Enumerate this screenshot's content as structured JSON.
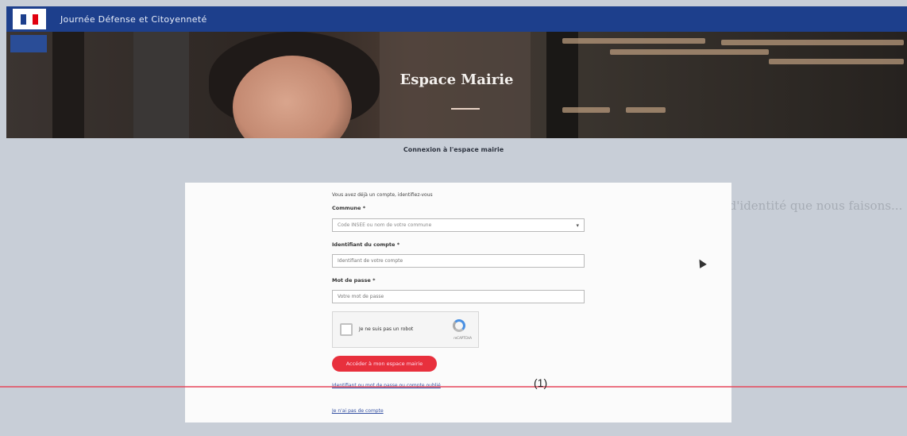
{
  "header": {
    "app_title": "Journée Défense et Citoyenneté",
    "side_tab": "",
    "flag_colors": [
      "#1d3f8c",
      "#ffffff",
      "#e1000f"
    ]
  },
  "hero": {
    "title": "Espace Mairie"
  },
  "subtitle": "Connexion à l'espace mairie",
  "ghost_text": "un numéro unique : celle des cartes d'identité que nous faisons...",
  "form": {
    "intro": "Vous avez déjà un compte, identifiez-vous",
    "commune_label": "Commune *",
    "commune_placeholder": "Code INSEE ou nom de votre commune",
    "identifiant_label": "Identifiant du compte *",
    "identifiant_placeholder": "Identifiant de votre compte",
    "password_label": "Mot de passe *",
    "password_placeholder": "Votre mot de passe",
    "captcha_label": "Je ne suis pas un robot",
    "captcha_brand": "reCAPTCHA",
    "submit_label": "Accéder à mon espace mairie",
    "forgot_link": "Identifiant ou mot de passe ou compte oublié",
    "no_account_link": "Je n'ai pas de compte"
  },
  "annotation": "(1)",
  "colors": {
    "topbar": "#1d3f8c",
    "submit": "#e8303d",
    "link": "#3652a3",
    "annotation_line": "#e6465a"
  }
}
